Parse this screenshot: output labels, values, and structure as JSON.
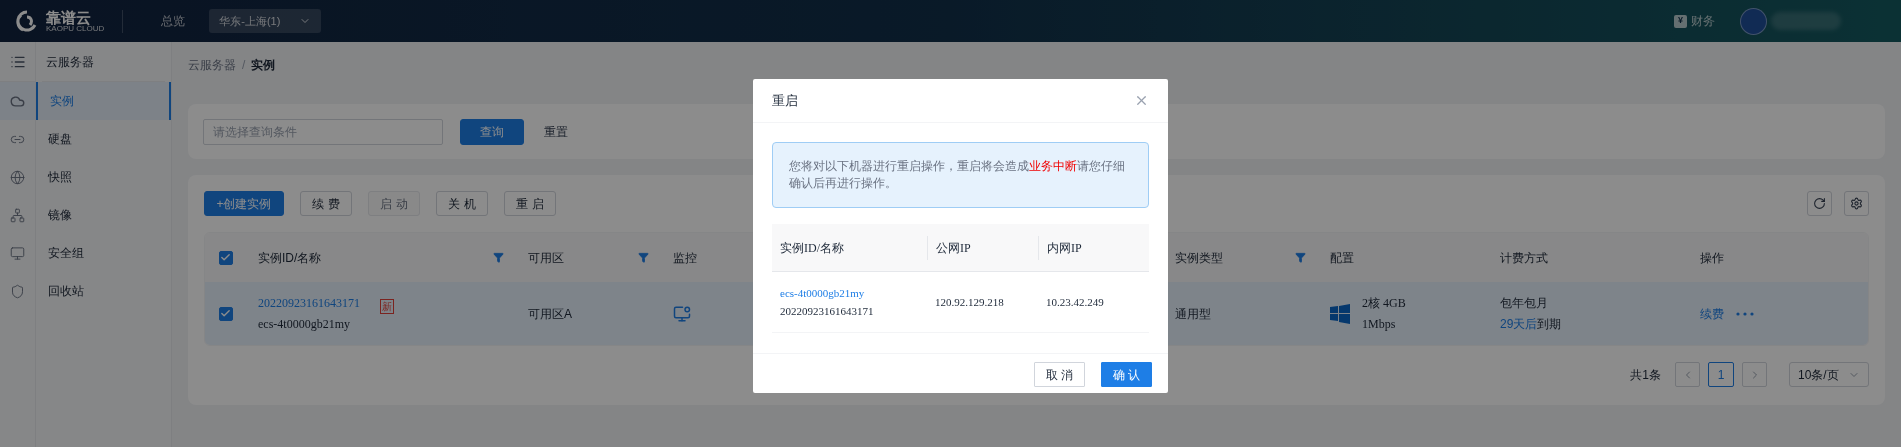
{
  "header": {
    "logo": {
      "name": "靠谱云",
      "subtitle": "KAOPU CLOUD"
    },
    "nav": [
      {
        "label": "总览"
      }
    ],
    "region_select": {
      "value": "华东-上海(1)"
    },
    "finance": {
      "label": "财务",
      "icon_text": "¥"
    }
  },
  "rail": {
    "items": [
      {
        "selected": true
      },
      {
        "selected": false
      },
      {
        "selected": false
      },
      {
        "selected": false
      },
      {
        "selected": false
      },
      {
        "selected": false
      }
    ]
  },
  "sidebar": {
    "title": "云服务器",
    "items": [
      {
        "label": "实例",
        "selected": true
      },
      {
        "label": "硬盘",
        "selected": false
      },
      {
        "label": "快照",
        "selected": false
      },
      {
        "label": "镜像",
        "selected": false
      },
      {
        "label": "安全组",
        "selected": false
      },
      {
        "label": "回收站",
        "selected": false
      }
    ]
  },
  "breadcrumb": {
    "separator": "/",
    "items": [
      "云服务器",
      "实例"
    ]
  },
  "search": {
    "placeholder": "请选择查询条件",
    "buttons": [
      {
        "label": "查询",
        "kind": "primary"
      },
      {
        "label": "重置",
        "kind": "text"
      }
    ]
  },
  "toolbar": {
    "buttons": [
      {
        "label": "+创建实例",
        "kind": "primary",
        "disabled": false
      },
      {
        "label": "续 费",
        "kind": "default",
        "disabled": false
      },
      {
        "label": "启 动",
        "kind": "default",
        "disabled": true
      },
      {
        "label": "关 机",
        "kind": "default",
        "disabled": false
      },
      {
        "label": "重 启",
        "kind": "default",
        "disabled": false
      }
    ]
  },
  "table": {
    "all_checked": true,
    "columns": [
      {
        "label": "实例ID/名称",
        "filter": true
      },
      {
        "label": "可用区",
        "filter": true
      },
      {
        "label": "监控",
        "filter": false
      },
      {
        "label": "实例类型",
        "filter": true
      },
      {
        "label": "配置",
        "filter": false
      },
      {
        "label": "计费方式",
        "filter": false
      },
      {
        "label": "操作",
        "filter": false
      }
    ],
    "rows": [
      {
        "checked": true,
        "selected": true,
        "id": "20220923161643171",
        "badge": "新",
        "name": "ecs-4t0000gb21my",
        "zone": "可用区A",
        "type": "通用型",
        "config": [
          "2核 4GB",
          "1Mbps"
        ],
        "billing": "包年包月",
        "expire": {
          "highlight": "29天后",
          "suffix": "到期"
        },
        "actions": [
          {
            "label": "续费"
          }
        ]
      }
    ]
  },
  "pagination": {
    "total": "共1条",
    "pages": [
      {
        "label": "1",
        "selected": true
      }
    ],
    "page_size": "10条/页"
  },
  "dialog": {
    "title": "重启",
    "notice": [
      {
        "text": "您将对以下机器进行重启操作，重启将会造成",
        "emphasis": false
      },
      {
        "text": "业务中断",
        "emphasis": true
      },
      {
        "text": "请您仔细确认后再进行操作。",
        "emphasis": false
      }
    ],
    "columns": [
      "实例ID/名称",
      "公网IP",
      "内网IP"
    ],
    "rows": [
      {
        "name": "ecs-4t0000gb21my",
        "id": "20220923161643171",
        "public_ip": "120.92.129.218",
        "private_ip": "10.23.42.249"
      }
    ],
    "buttons": [
      {
        "label": "取 消",
        "kind": "default"
      },
      {
        "label": "确 认",
        "kind": "primary"
      }
    ]
  }
}
